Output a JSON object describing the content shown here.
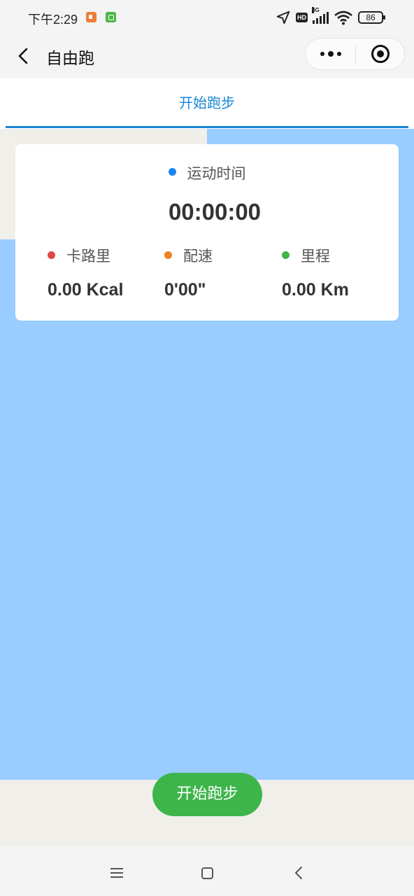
{
  "status_bar": {
    "time": "下午2:29",
    "network": "4G",
    "hd_badge": "HD",
    "battery": "86",
    "icons": [
      "screen-record-icon",
      "android-icon",
      "location-arrow-icon",
      "signal-icon",
      "wifi-icon",
      "battery-icon"
    ]
  },
  "nav": {
    "title": "自由跑",
    "icons": [
      "back-arrow-icon",
      "more-dots-icon",
      "target-close-icon"
    ]
  },
  "tabs": {
    "active_label": "开始跑步"
  },
  "stats": {
    "time_label": "运动时间",
    "time_value": "00:00:00",
    "calories_label": "卡路里",
    "calories_value": "0.00 Kcal",
    "pace_label": "配速",
    "pace_value": "0'00\"",
    "distance_label": "里程",
    "distance_value": "0.00 Km"
  },
  "start_button": {
    "label": "开始跑步"
  },
  "colors": {
    "accent_blue": "#1a85d6",
    "map_water": "#99ccff",
    "map_land": "#f1efea",
    "start_green": "#3db54a",
    "time_dot": "#1a85f0",
    "calories_dot": "#e04848",
    "pace_dot": "#f08024",
    "distance_dot": "#3db54a"
  },
  "system_nav": {
    "icons": [
      "menu-icon",
      "home-square-icon",
      "back-chevron-icon"
    ]
  }
}
